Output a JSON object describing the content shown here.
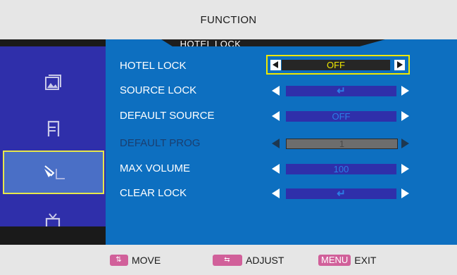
{
  "header": {
    "title": "FUNCTION"
  },
  "sub_tab": {
    "label": "HOTEL LOCK"
  },
  "sidebar": {
    "items": [
      {
        "icon": "picture-icon",
        "active": false
      },
      {
        "icon": "sound-icon",
        "active": false
      },
      {
        "icon": "function-icon",
        "active": true
      },
      {
        "icon": "tv-icon",
        "active": false
      }
    ]
  },
  "rows": [
    {
      "label": "HOTEL LOCK",
      "value": "OFF",
      "selected": true,
      "disabled": false
    },
    {
      "label": "SOURCE LOCK",
      "value": "↵",
      "selected": false,
      "disabled": false
    },
    {
      "label": "DEFAULT SOURCE",
      "value": "OFF",
      "selected": false,
      "disabled": false
    },
    {
      "label": "DEFAULT PROG",
      "value": "1",
      "selected": false,
      "disabled": true
    },
    {
      "label": "MAX VOLUME",
      "value": "100",
      "selected": false,
      "disabled": false
    },
    {
      "label": "CLEAR LOCK",
      "value": "↵",
      "selected": false,
      "disabled": false
    }
  ],
  "footer": {
    "move_key": "⇅",
    "move_label": "MOVE",
    "adjust_key": "⇆",
    "adjust_label": "ADJUST",
    "menu_key": "MENU",
    "exit_label": "EXIT"
  },
  "colors": {
    "sidebar_bg": "#2f2faa",
    "content_bg": "#0d6fc0",
    "selection": "#f0e800",
    "key_bg": "#d1609a"
  }
}
